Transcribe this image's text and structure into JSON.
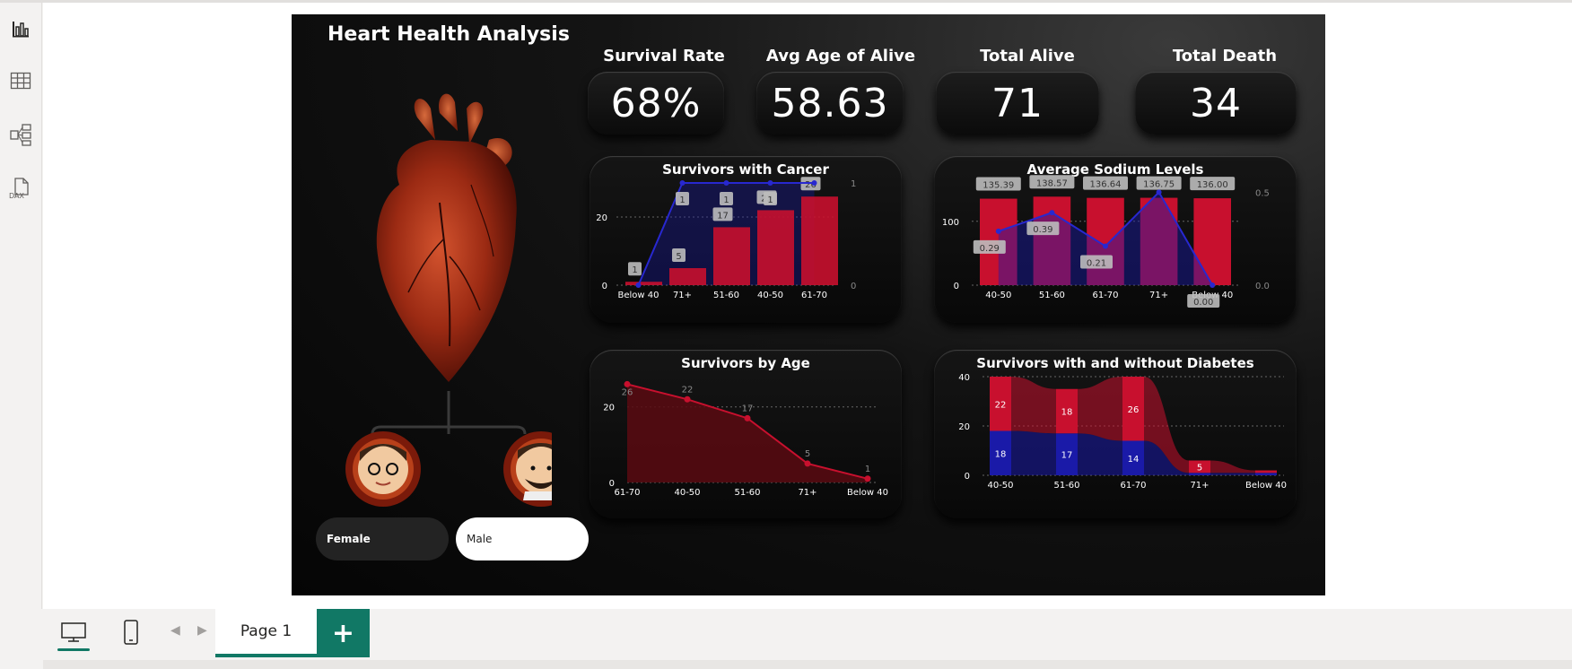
{
  "app": {
    "left_rail": [
      "report-view-icon",
      "table-view-icon",
      "model-view-icon",
      "dax-query-view-icon"
    ],
    "dax_label": "DAX",
    "page_tab": "Page 1",
    "add_page": "+"
  },
  "dashboard": {
    "title": "Heart Health Analysis",
    "kpis": [
      {
        "label": "Survival Rate",
        "value": "68%"
      },
      {
        "label": "Avg Age of Alive",
        "value": "58.63"
      },
      {
        "label": "Total Alive",
        "value": "71"
      },
      {
        "label": "Total Death",
        "value": "34"
      }
    ],
    "slicers": {
      "female": "Female",
      "male": "Male"
    },
    "colors": {
      "red": "#c8102e",
      "blue": "#1a1aa8",
      "dark_red": "#5a0a12"
    }
  },
  "chart_data": [
    {
      "type": "bar",
      "title": "Survivors with Cancer",
      "categories": [
        "Below 40",
        "71+",
        "51-60",
        "40-50",
        "61-70"
      ],
      "values": [
        1,
        5,
        17,
        22,
        26
      ],
      "yticks": [
        "0",
        "20"
      ],
      "ylim": [
        0,
        30
      ],
      "line": {
        "values": [
          0,
          1,
          1,
          1,
          1
        ],
        "ylim": [
          0,
          1
        ],
        "yticks": [
          "0",
          "1"
        ],
        "labels": [
          "",
          "1",
          "1",
          "1",
          ""
        ]
      }
    },
    {
      "type": "bar",
      "title": "Average Sodium Levels",
      "categories": [
        "40-50",
        "51-60",
        "61-70",
        "71+",
        "Below 40"
      ],
      "values": [
        135.39,
        138.57,
        136.64,
        136.75,
        136.0
      ],
      "value_labels": [
        "135.39",
        "138.57",
        "136.64",
        "136.75",
        "136.00"
      ],
      "yticks": [
        "0",
        "100"
      ],
      "ylim": [
        0,
        160
      ],
      "line": {
        "values": [
          0.29,
          0.39,
          0.21,
          0.5,
          0.0
        ],
        "labels": [
          "0.29",
          "0.39",
          "0.21",
          "",
          "0.00"
        ],
        "ylim": [
          0,
          0.55
        ],
        "yticks": [
          "0.0",
          "0.5"
        ]
      }
    },
    {
      "type": "area",
      "title": "Survivors by Age",
      "categories": [
        "61-70",
        "40-50",
        "51-60",
        "71+",
        "Below 40"
      ],
      "values": [
        26,
        22,
        17,
        5,
        1
      ],
      "yticks": [
        "0",
        "20"
      ],
      "ylim": [
        0,
        28
      ]
    },
    {
      "type": "bar",
      "title": "Survivors with and without Diabetes",
      "categories": [
        "40-50",
        "51-60",
        "61-70",
        "71+",
        "Below 40"
      ],
      "series": [
        {
          "values": [
            18,
            17,
            14,
            1,
            1
          ]
        },
        {
          "values": [
            22,
            18,
            26,
            5,
            1
          ]
        }
      ],
      "labels": [
        [
          "18",
          "22"
        ],
        [
          "17",
          "18"
        ],
        [
          "14",
          "26"
        ],
        [
          "",
          "5"
        ],
        [
          "",
          ""
        ]
      ],
      "yticks": [
        "0",
        "20",
        "40"
      ],
      "ylim": [
        0,
        40
      ]
    }
  ]
}
